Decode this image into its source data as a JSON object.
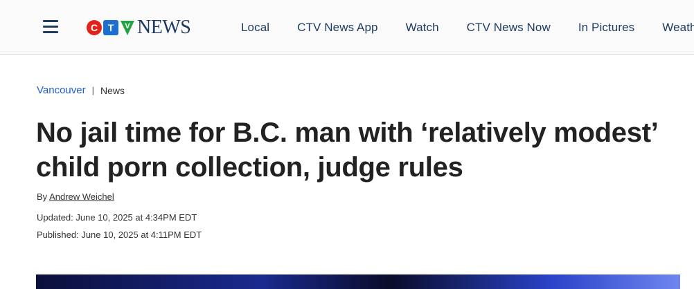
{
  "header": {
    "menu_icon": "hamburger-menu-icon",
    "logo": {
      "letters": [
        "C",
        "T",
        "V"
      ],
      "colors": [
        "#e2231a",
        "#1a6fd0",
        "#25a244"
      ],
      "wordmark": "NEWS"
    },
    "nav": [
      "Local",
      "CTV News App",
      "Watch",
      "CTV News Now",
      "In Pictures",
      "Weather"
    ]
  },
  "article": {
    "breadcrumb": {
      "section": "Vancouver",
      "separator": "|",
      "category": "News"
    },
    "headline": "No jail time for B.C. man with ‘relatively modest’ child porn collection, judge rules",
    "byline_prefix": "By",
    "author": "Andrew Weichel",
    "updated": "Updated: June 10, 2025 at 4:34PM EDT",
    "published": "Published: June 10, 2025 at 4:11PM EDT"
  }
}
